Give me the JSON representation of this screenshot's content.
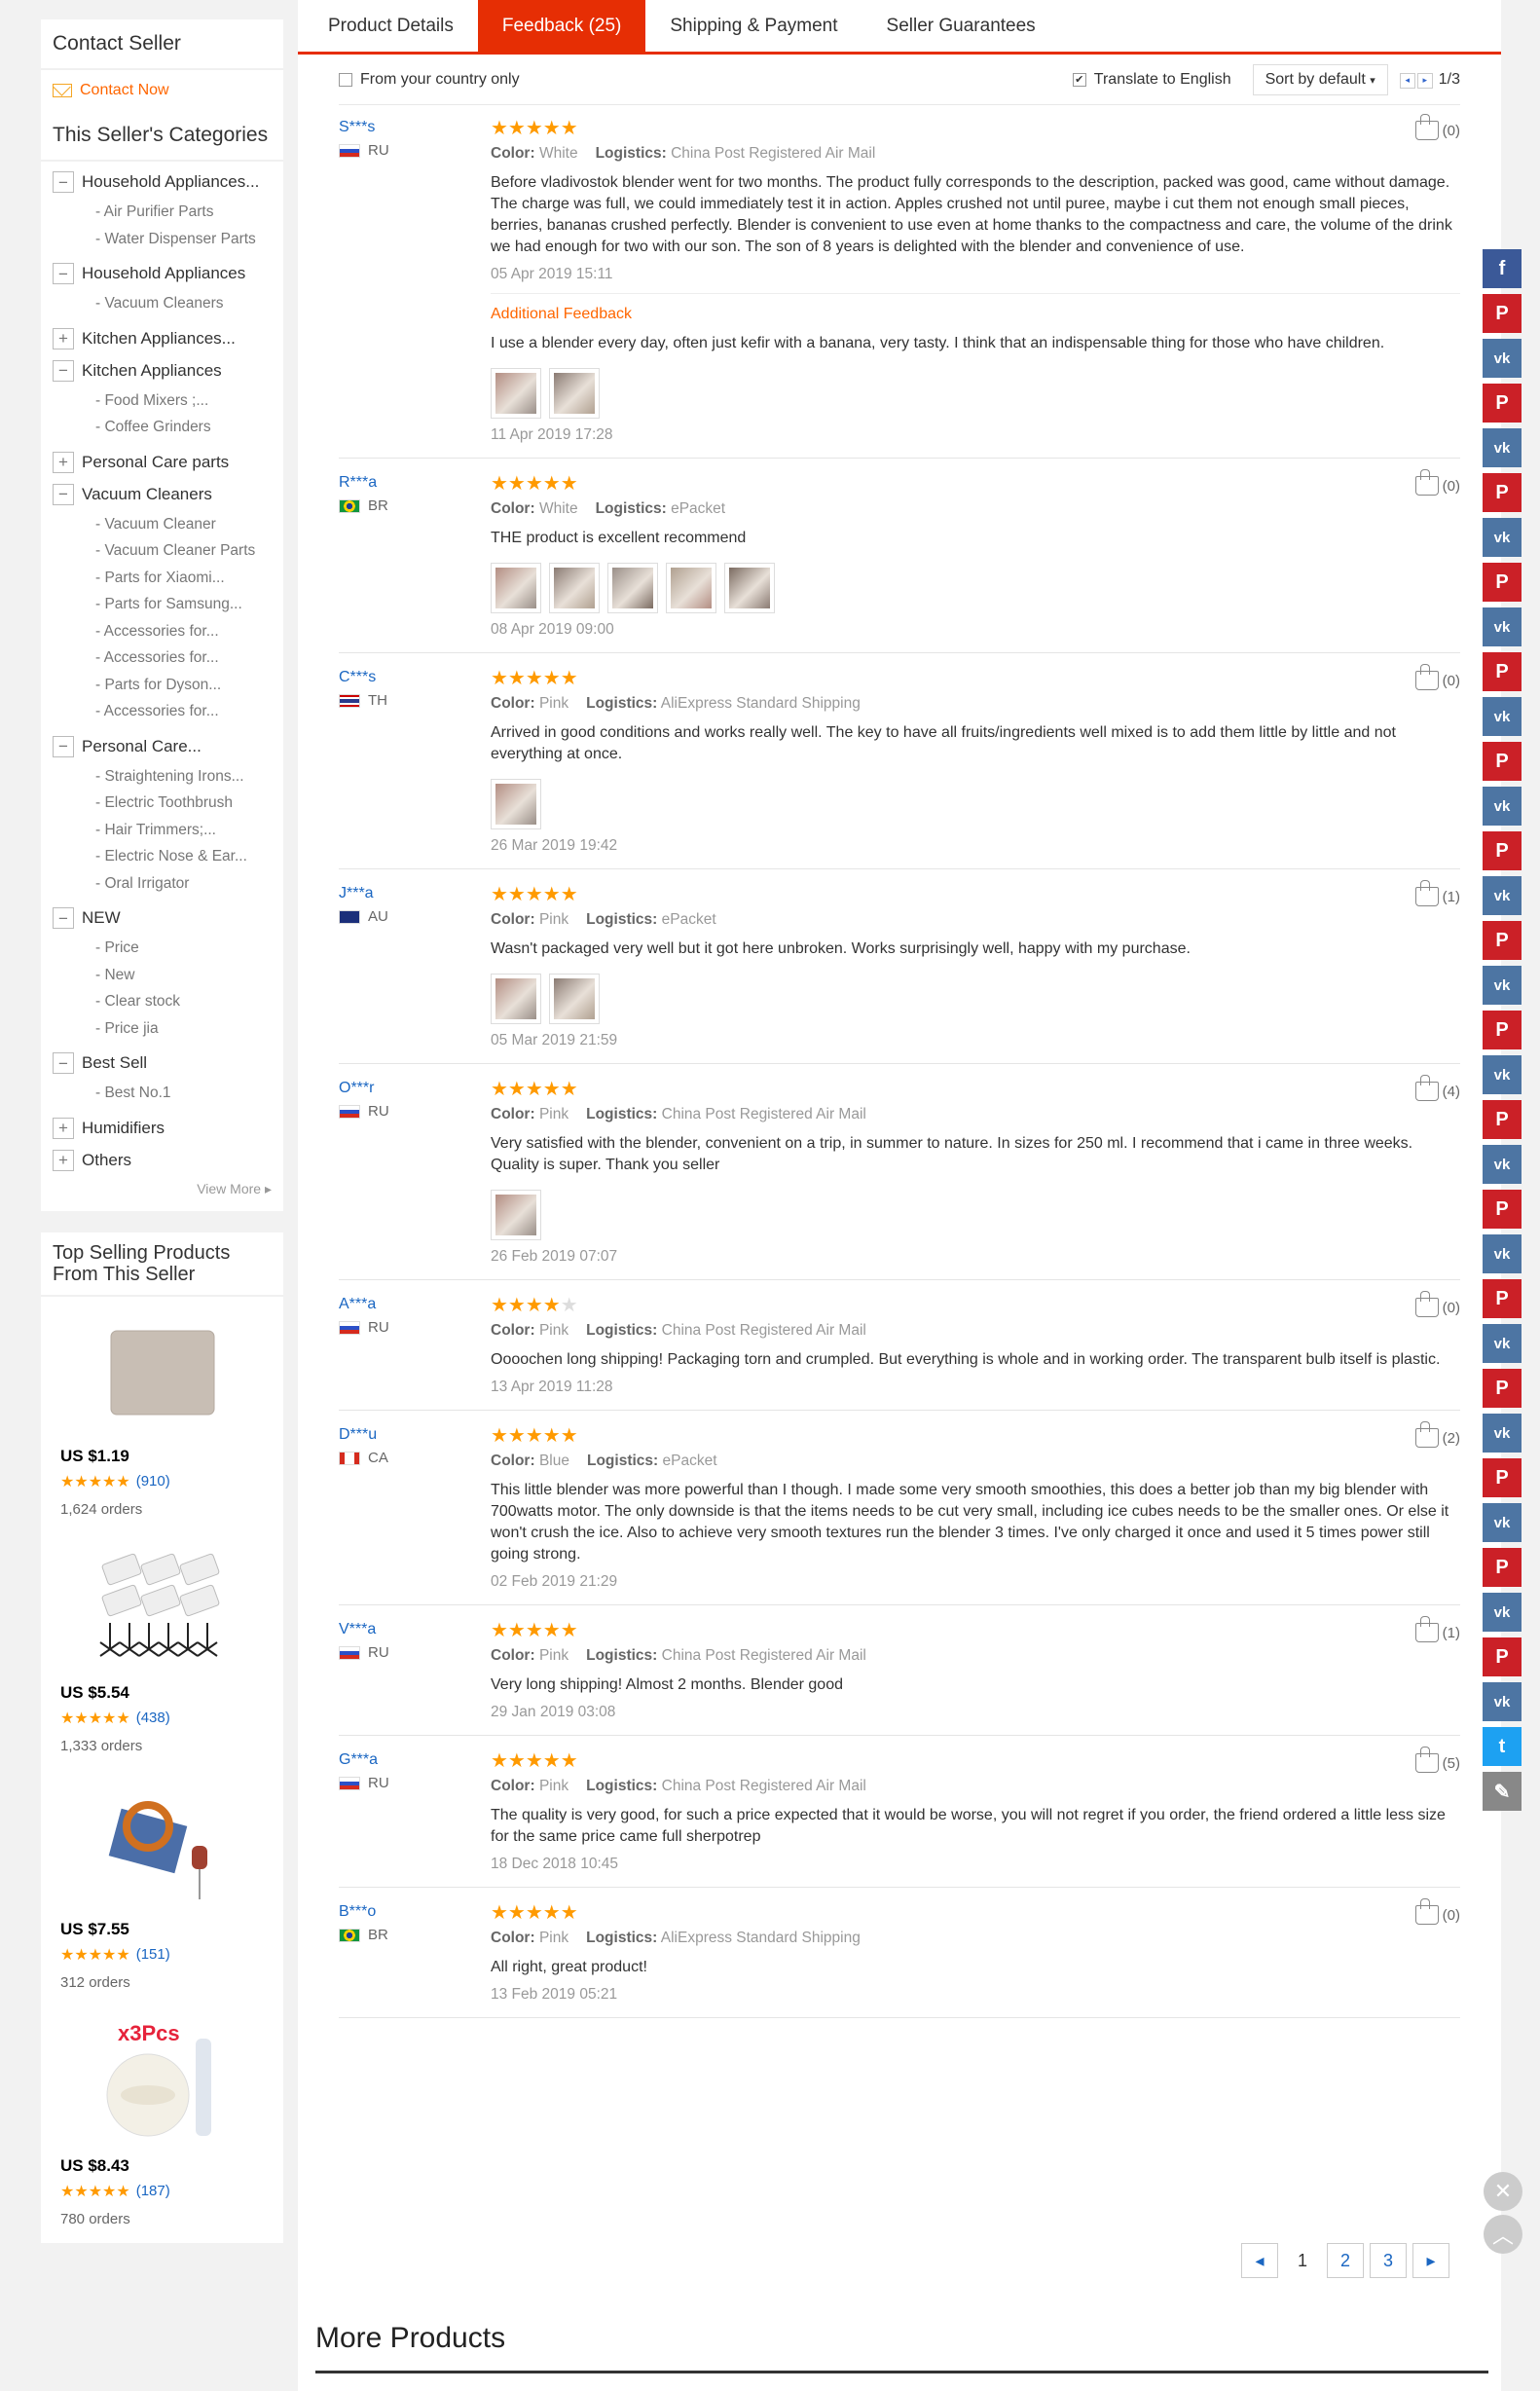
{
  "sidebar": {
    "contact": {
      "title": "Contact Seller",
      "link": "Contact Now"
    },
    "categories_title": "This Seller's Categories",
    "categories": [
      {
        "label": "Household Appliances...",
        "toggle": "−",
        "subs": [
          "- Air Purifier Parts",
          "- Water Dispenser Parts"
        ]
      },
      {
        "label": "Household Appliances",
        "toggle": "−",
        "subs": [
          "- Vacuum Cleaners"
        ]
      },
      {
        "label": "Kitchen Appliances...",
        "toggle": "+",
        "subs": []
      },
      {
        "label": "Kitchen Appliances",
        "toggle": "−",
        "subs": [
          "- Food Mixers ;...",
          "- Coffee Grinders"
        ]
      },
      {
        "label": "Personal Care parts",
        "toggle": "+",
        "subs": []
      },
      {
        "label": "Vacuum Cleaners",
        "toggle": "−",
        "subs": [
          "- Vacuum Cleaner",
          "- Vacuum Cleaner Parts",
          "- Parts for Xiaomi...",
          "- Parts for Samsung...",
          "- Accessories for...",
          "- Accessories for...",
          "- Parts for Dyson...",
          "- Accessories for..."
        ]
      },
      {
        "label": "Personal Care...",
        "toggle": "−",
        "subs": [
          "- Straightening Irons...",
          "- Electric Toothbrush",
          "- Hair Trimmers;...",
          "- Electric Nose & Ear...",
          "- Oral Irrigator"
        ]
      },
      {
        "label": "NEW",
        "toggle": "−",
        "subs": [
          "- Price",
          "- New",
          "- Clear stock",
          "- Price jia"
        ]
      },
      {
        "label": "Best Sell",
        "toggle": "−",
        "subs": [
          "- Best No.1"
        ]
      },
      {
        "label": "Humidifiers",
        "toggle": "+",
        "subs": []
      },
      {
        "label": "Others",
        "toggle": "+",
        "subs": []
      }
    ],
    "view_more": "View More",
    "top_selling": {
      "title": "Top Selling Products From This Seller",
      "items": [
        {
          "price": "US $1.19",
          "stars": "★★★★★",
          "count": "(910)",
          "orders": "1,624 orders"
        },
        {
          "price": "US $5.54",
          "stars": "★★★★★",
          "count": "(438)",
          "orders": "1,333 orders"
        },
        {
          "price": "US $7.55",
          "stars": "★★★★★",
          "count": "(151)",
          "orders": "312 orders"
        },
        {
          "price": "US $8.43",
          "stars": "★★★★★",
          "count": "(187)",
          "orders": "780 orders",
          "badge": "x3Pcs"
        }
      ]
    }
  },
  "tabs": [
    "Product Details",
    "Feedback (25)",
    "Shipping & Payment",
    "Seller Guarantees"
  ],
  "filter": {
    "country_only": "From your country only",
    "translate": "Translate to English",
    "sort": "Sort by default",
    "page": "1/3"
  },
  "labels": {
    "color": "Color:",
    "logistics": "Logistics:",
    "additional": "Additional Feedback"
  },
  "reviews": [
    {
      "user": "S***s",
      "country": "RU",
      "stars": "★★★★★",
      "stars_off": "",
      "color": "White",
      "logistics": "China Post Registered Air Mail",
      "text": "Before vladivostok blender went for two months. The product fully corresponds to the description, packed was good, came without damage. The charge was full, we could immediately test it in action. Apples crushed not until puree, maybe i cut them not enough small pieces, berries, bananas crushed perfectly. Blender is convenient to use even at home thanks to the compactness and care, the volume of the drink we had enough for two with our son. The son of 8 years is delighted with the blender and convenience of use.",
      "date": "05 Apr 2019 15:11",
      "helpful": "(0)",
      "additional": {
        "text": "I use a blender every day, often just kefir with a banana, very tasty. I think that an indispensable thing for those who have children.",
        "date": "11 Apr 2019 17:28",
        "pics": 2
      }
    },
    {
      "user": "R***a",
      "country": "BR",
      "stars": "★★★★★",
      "stars_off": "",
      "color": "White",
      "logistics": "ePacket",
      "text": "THE product is excellent recommend",
      "date": "08 Apr 2019 09:00",
      "helpful": "(0)",
      "pics": 5
    },
    {
      "user": "C***s",
      "country": "TH",
      "stars": "★★★★★",
      "stars_off": "",
      "color": "Pink",
      "logistics": "AliExpress Standard Shipping",
      "text": "Arrived in good conditions and works really well. The key to have all fruits/ingredients well mixed is to add them little by little and not everything at once.",
      "date": "26 Mar 2019 19:42",
      "helpful": "(0)",
      "pics": 1
    },
    {
      "user": "J***a",
      "country": "AU",
      "stars": "★★★★★",
      "stars_off": "",
      "color": "Pink",
      "logistics": "ePacket",
      "text": "Wasn't packaged very well but it got here unbroken. Works surprisingly well, happy with my purchase.",
      "date": "05 Mar 2019 21:59",
      "helpful": "(1)",
      "pics": 2
    },
    {
      "user": "O***r",
      "country": "RU",
      "stars": "★★★★★",
      "stars_off": "",
      "color": "Pink",
      "logistics": "China Post Registered Air Mail",
      "text": "Very satisfied with the blender, convenient on a trip, in summer to nature. In sizes for 250 ml. I recommend that i came in three weeks. Quality is super. Thank you seller",
      "date": "26 Feb 2019 07:07",
      "helpful": "(4)",
      "pics": 1
    },
    {
      "user": "A***a",
      "country": "RU",
      "stars": "★★★★",
      "stars_off": "★",
      "color": "Pink",
      "logistics": "China Post Registered Air Mail",
      "text": "Oooochen long shipping! Packaging torn and crumpled. But everything is whole and in working order. The transparent bulb itself is plastic.",
      "date": "13 Apr 2019 11:28",
      "helpful": "(0)",
      "pics": 0
    },
    {
      "user": "D***u",
      "country": "CA",
      "stars": "★★★★★",
      "stars_off": "",
      "color": "Blue",
      "logistics": "ePacket",
      "text": "This little blender was more powerful than I though. I made some very smooth smoothies, this does a better job than my big blender with 700watts motor. The only downside is that the items needs to be cut very small, including ice cubes needs to be the smaller ones. Or else it won't crush the ice. Also to achieve very smooth textures run the blender 3 times. I've only charged it once and used it 5 times power still going strong.",
      "date": "02 Feb 2019 21:29",
      "helpful": "(2)",
      "pics": 0
    },
    {
      "user": "V***a",
      "country": "RU",
      "stars": "★★★★★",
      "stars_off": "",
      "color": "Pink",
      "logistics": "China Post Registered Air Mail",
      "text": "Very long shipping! Almost 2 months. Blender good",
      "date": "29 Jan 2019 03:08",
      "helpful": "(1)",
      "pics": 0
    },
    {
      "user": "G***a",
      "country": "RU",
      "stars": "★★★★★",
      "stars_off": "",
      "color": "Pink",
      "logistics": "China Post Registered Air Mail",
      "text": "The quality is very good, for such a price expected that it would be worse, you will not regret if you order, the friend ordered a little less size for the same price came full sherpotrep",
      "date": "18 Dec 2018 10:45",
      "helpful": "(5)",
      "pics": 0
    },
    {
      "user": "B***o",
      "country": "BR",
      "stars": "★★★★★",
      "stars_off": "",
      "color": "Pink",
      "logistics": "AliExpress Standard Shipping",
      "text": "All right, great product!",
      "date": "13 Feb 2019 05:21",
      "helpful": "(0)",
      "pics": 0
    }
  ],
  "pagination": {
    "prev": "◂",
    "pages": [
      "1",
      "2",
      "3"
    ],
    "next": "▸"
  },
  "more_products": "More Products",
  "share": {
    "icons": [
      "facebook-icon",
      "pinterest-icon",
      "vk-icon",
      "pinterest-icon",
      "vk-icon",
      "pinterest-icon",
      "vk-icon",
      "pinterest-icon",
      "vk-icon",
      "pinterest-icon",
      "vk-icon",
      "pinterest-icon",
      "vk-icon",
      "pinterest-icon",
      "vk-icon",
      "pinterest-icon",
      "vk-icon",
      "pinterest-icon",
      "vk-icon",
      "pinterest-icon",
      "vk-icon",
      "pinterest-icon",
      "vk-icon",
      "pinterest-icon",
      "vk-icon",
      "pinterest-icon",
      "vk-icon",
      "pinterest-icon",
      "vk-icon",
      "pinterest-icon",
      "vk-icon",
      "pinterest-icon",
      "vk-icon",
      "twitter-icon",
      "edit-icon"
    ],
    "glyphs": {
      "facebook-icon": "f",
      "pinterest-icon": "P",
      "vk-icon": "vk",
      "twitter-icon": "t",
      "edit-icon": "✎"
    }
  },
  "colors": {
    "accent": "#e62e04",
    "link": "#1a66c2",
    "star": "#ff9a00",
    "orange": "#ff6600"
  }
}
